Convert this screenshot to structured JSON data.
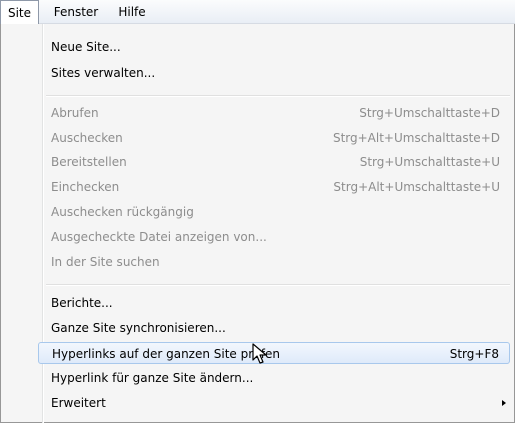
{
  "menubar": {
    "items": [
      {
        "label": "Site",
        "active": true
      },
      {
        "label": "Fenster",
        "active": false
      },
      {
        "label": "Hilfe",
        "active": false
      }
    ]
  },
  "menu": {
    "items": [
      {
        "label": "Neue Site...",
        "shortcut": "",
        "disabled": false
      },
      {
        "label": "Sites verwalten...",
        "shortcut": "",
        "disabled": false
      },
      {
        "label": "Abrufen",
        "shortcut": "Strg+Umschalttaste+D",
        "disabled": true
      },
      {
        "label": "Auschecken",
        "shortcut": "Strg+Alt+Umschalttaste+D",
        "disabled": true
      },
      {
        "label": "Bereitstellen",
        "shortcut": "Strg+Umschalttaste+U",
        "disabled": true
      },
      {
        "label": "Einchecken",
        "shortcut": "Strg+Alt+Umschalttaste+U",
        "disabled": true
      },
      {
        "label": "Auschecken rückgängig",
        "shortcut": "",
        "disabled": true
      },
      {
        "label": "Ausgecheckte Datei anzeigen von...",
        "shortcut": "",
        "disabled": true
      },
      {
        "label": "In der Site suchen",
        "shortcut": "",
        "disabled": true
      },
      {
        "label": "Berichte...",
        "shortcut": "",
        "disabled": false
      },
      {
        "label": "Ganze Site synchronisieren...",
        "shortcut": "",
        "disabled": false
      },
      {
        "label": "Hyperlinks auf der ganzen Site prüfen",
        "shortcut": "Strg+F8",
        "disabled": false,
        "highlighted": true
      },
      {
        "label": "Hyperlink für ganze Site ändern...",
        "shortcut": "",
        "disabled": false
      },
      {
        "label": "Erweitert",
        "shortcut": "",
        "disabled": false,
        "submenu": true
      }
    ]
  },
  "colors": {
    "disabled_text": "#8d8d8d",
    "highlight_border": "#a8c8ec",
    "highlight_fill": "#dfeafa"
  }
}
